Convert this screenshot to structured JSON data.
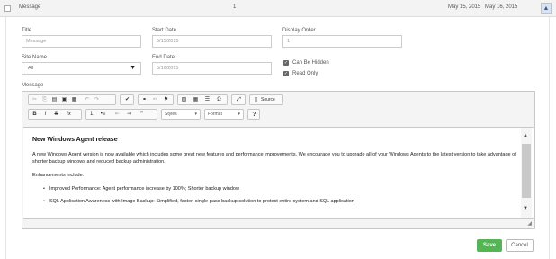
{
  "row": {
    "title": "Message",
    "display_order": "1",
    "start_date": "May 15, 2015",
    "end_date": "May 16, 2015",
    "collapse_icon": "chevron-up-icon"
  },
  "form": {
    "title_label": "Title",
    "title_placeholder": "Message",
    "start_date_label": "Start Date",
    "start_date_value": "5/15/2015",
    "display_order_label": "Display Order",
    "display_order_value": "1",
    "site_name_label": "Site Name",
    "site_name_value": "All",
    "end_date_label": "End Date",
    "end_date_value": "5/16/2015",
    "can_be_hidden_label": "Can Be Hidden",
    "can_be_hidden_checked": true,
    "read_only_label": "Read Only",
    "read_only_checked": true,
    "message_label": "Message"
  },
  "editor": {
    "source_label": "Source",
    "styles_label": "Styles",
    "format_label": "Format",
    "help_label": "?",
    "content": {
      "heading": "New Windows Agent release",
      "paragraph": "A new Windows Agent version is now available which includes some great new features and performance improvements. We encourage you to upgrade all of your Windows Agents to the latest version to take advantage of shorter backup windows and reduced backup administration.",
      "enhancements_label": "Enhancements include:",
      "items": [
        "Improved Performance: Agent performance increase by 100%; Shorter backup window",
        "SQL Application Awareness with Image Backup: Simplified, faster, single-pass backup solution to protect entire system and SQL application"
      ]
    }
  },
  "actions": {
    "save_label": "Save",
    "cancel_label": "Cancel"
  },
  "colors": {
    "save_button": "#55b555",
    "header_bg": "#f3f3f3"
  }
}
